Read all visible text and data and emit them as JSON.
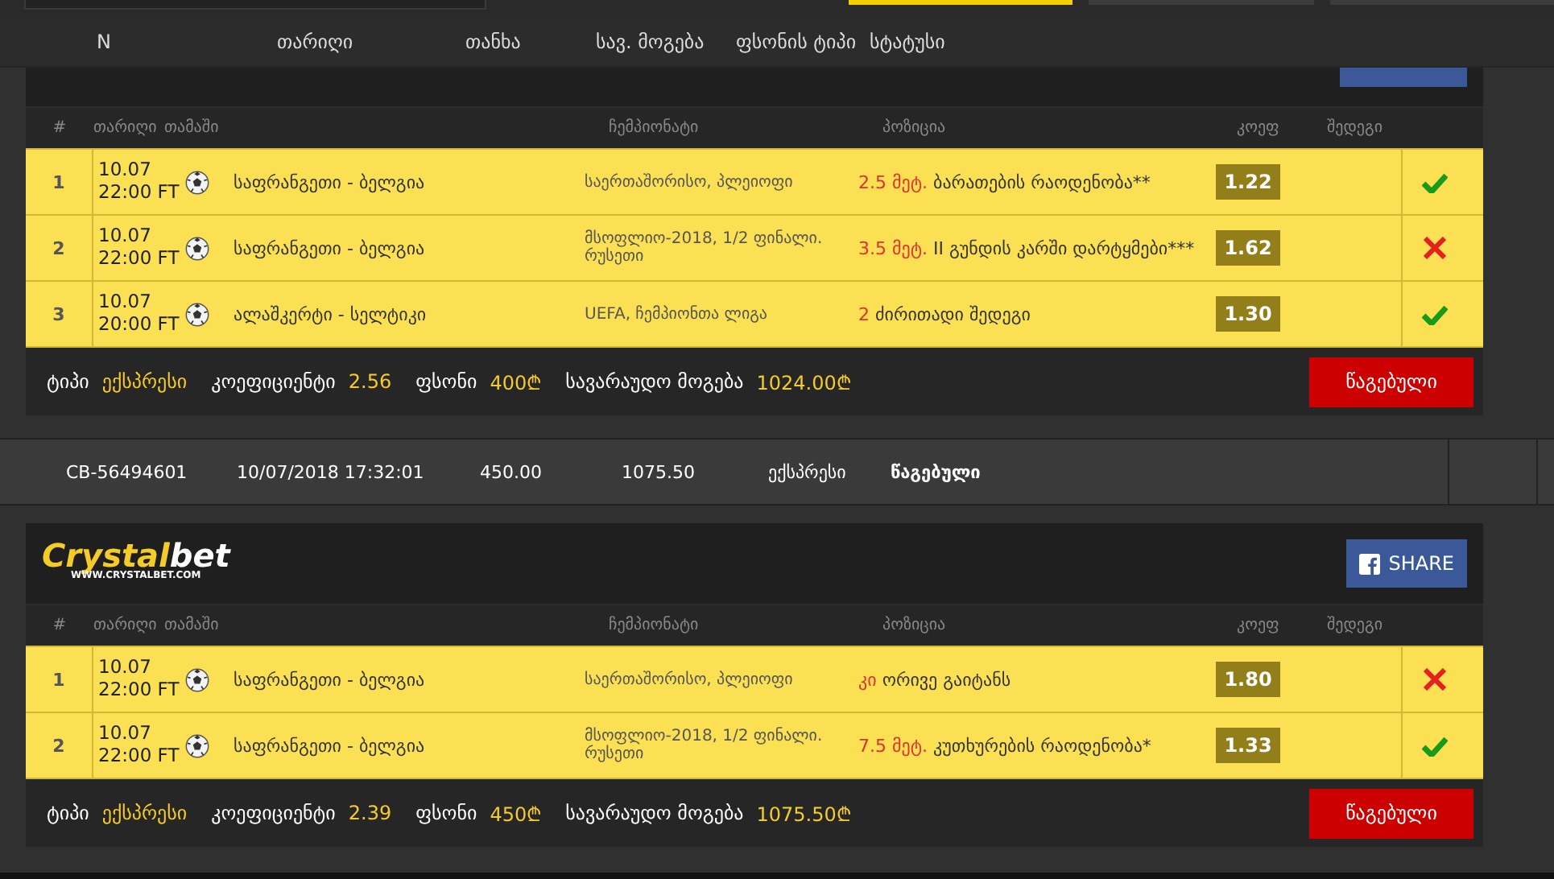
{
  "header": {
    "columns": [
      "N",
      "თარიღი",
      "თანხა",
      "სავ. მოგება",
      "ფსონის ტიპი",
      "სტატუსი"
    ]
  },
  "cards": [
    {
      "columns": [
        "#",
        "თარიღი",
        "თამაში",
        "ჩემპიონატი",
        "პოზიცია",
        "კოეფ",
        "შედეგი"
      ],
      "rows": [
        {
          "n": "1",
          "date": "10.07",
          "time": "22:00 FT",
          "match": "საფრანგეთი - ბელგია",
          "championship": "საერთაშორისო, პლეიოფი",
          "line": "2.5 მეტ.",
          "position": "ბარათების რაოდენობა**",
          "odds": "1.22",
          "won": true
        },
        {
          "n": "2",
          "date": "10.07",
          "time": "22:00 FT",
          "match": "საფრანგეთი - ბელგია",
          "championship": "მსოფლიო-2018, 1/2 ფინალი. რუსეთი",
          "line": "3.5 მეტ.",
          "position": "II გუნდის კარში დარტყმები***",
          "odds": "1.62",
          "won": false
        },
        {
          "n": "3",
          "date": "10.07",
          "time": "20:00 FT",
          "match": "ალაშკერტი - სელტიკი",
          "championship": "UEFA, ჩემპიონთა ლიგა",
          "line": "2",
          "position": "ძირითადი შედეგი",
          "odds": "1.30",
          "won": true
        }
      ],
      "footer": [
        {
          "label": "ტიპი",
          "value": "ექსპრესი"
        },
        {
          "label": "კოეფიციენტი",
          "value": "2.56"
        },
        {
          "label": "ფსონი",
          "value": "400₾"
        },
        {
          "label": "სავარაუდო მოგება",
          "value": "1024.00₾"
        }
      ],
      "status": "წაგებული"
    },
    {
      "summary": [
        "CB-56494601",
        "10/07/2018 17:32:01",
        "450.00",
        "1075.50",
        "ექსპრესი",
        "წაგებული"
      ],
      "logo": {
        "brand_1": "Crystal",
        "brand_2": "bet",
        "url": "WWW.CRYSTALBET.COM"
      },
      "share": "SHARE",
      "columns": [
        "#",
        "თარიღი",
        "თამაში",
        "ჩემპიონატი",
        "პოზიცია",
        "კოეფ",
        "შედეგი"
      ],
      "rows": [
        {
          "n": "1",
          "date": "10.07",
          "time": "22:00 FT",
          "match": "საფრანგეთი - ბელგია",
          "championship": "საერთაშორისო, პლეიოფი",
          "line": "კი",
          "position": "ორივე გაიტანს",
          "odds": "1.80",
          "won": false
        },
        {
          "n": "2",
          "date": "10.07",
          "time": "22:00 FT",
          "match": "საფრანგეთი - ბელგია",
          "championship": "მსოფლიო-2018, 1/2 ფინალი. რუსეთი",
          "line": "7.5 მეტ.",
          "position": "კუთხურების რაოდენობა*",
          "odds": "1.33",
          "won": true
        }
      ],
      "footer": [
        {
          "label": "ტიპი",
          "value": "ექსპრესი"
        },
        {
          "label": "კოეფიციენტი",
          "value": "2.39"
        },
        {
          "label": "ფსონი",
          "value": "450₾"
        },
        {
          "label": "სავარაუდო მოგება",
          "value": "1075.50₾"
        }
      ],
      "status": "წაგებული"
    }
  ]
}
